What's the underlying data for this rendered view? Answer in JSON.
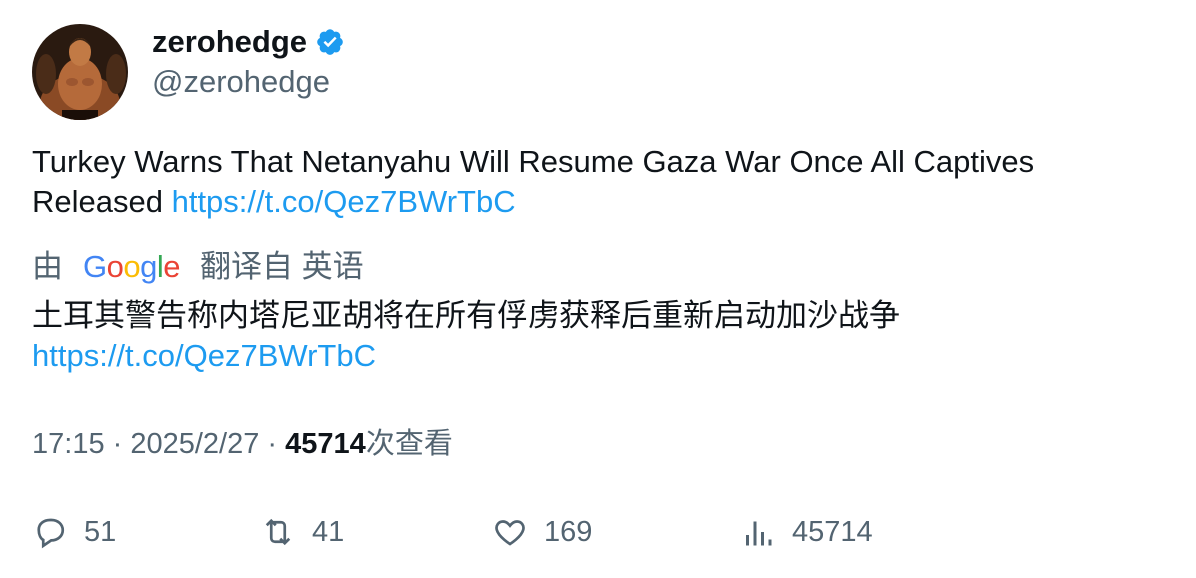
{
  "author": {
    "display_name": "zerohedge",
    "handle": "@zerohedge",
    "verified": true
  },
  "tweet": {
    "text": "Turkey Warns That Netanyahu Will Resume Gaza War Once All Captives Released ",
    "link": "https://t.co/Qez7BWrTbC"
  },
  "translation": {
    "prefix": "由",
    "provider": "Google",
    "suffix": "翻译自 英语",
    "text": "土耳其警告称内塔尼亚胡将在所有俘虏获释后重新启动加沙战争",
    "link": "https://t.co/Qez7BWrTbC"
  },
  "meta": {
    "time": "17:15",
    "separator": " · ",
    "date": "2025/2/27",
    "views_count": "45714",
    "views_label": "次查看"
  },
  "actions": {
    "replies": "51",
    "retweets": "41",
    "likes": "169",
    "views": "45714"
  },
  "colors": {
    "link": "#1d9bf0",
    "secondary_text": "#536471",
    "primary_text": "#0f1419",
    "verified_badge": "#1d9bf0"
  }
}
